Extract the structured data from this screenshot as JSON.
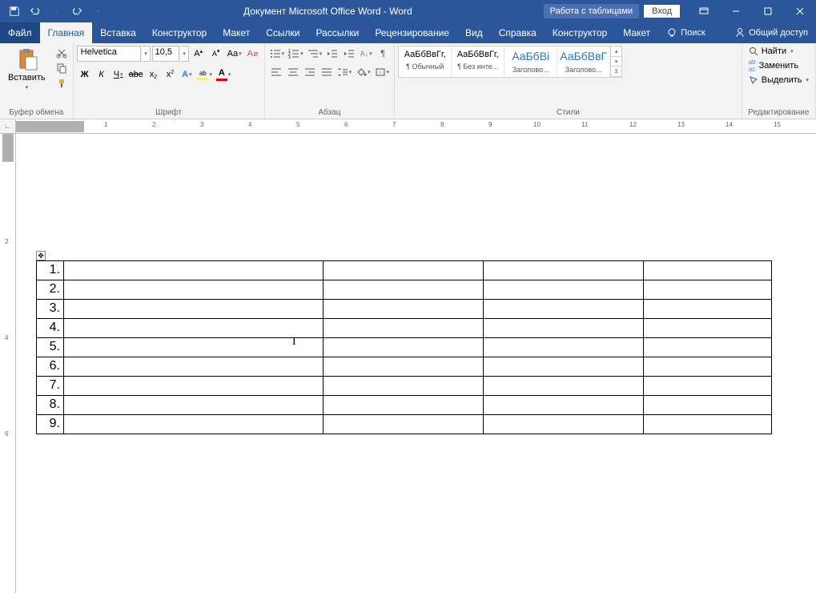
{
  "title": "Документ Microsoft Office Word - Word",
  "table_tools": "Работа с таблицами",
  "login": "Вход",
  "tabs": {
    "file": "Файл",
    "home": "Главная",
    "insert": "Вставка",
    "design": "Конструктор",
    "layout": "Макет",
    "refs": "Ссылки",
    "mail": "Рассылки",
    "review": "Рецензирование",
    "view": "Вид",
    "help": "Справка",
    "t_design": "Конструктор",
    "t_layout": "Макет",
    "search": "Поиск",
    "share": "Общий доступ"
  },
  "groups": {
    "clipboard": "Буфер обмена",
    "font": "Шрифт",
    "paragraph": "Абзац",
    "styles": "Стили",
    "editing": "Редактирование"
  },
  "clipboard": {
    "paste": "Вставить"
  },
  "font": {
    "name": "Helvetica",
    "size": "10,5",
    "bold": "Ж",
    "italic": "К",
    "underline": "Ч",
    "strike": "abc",
    "sub": "x",
    "sup": "x",
    "caseA": "Aa",
    "aBig": "A",
    "aSmall": "A",
    "clearA": "A",
    "textFx": "A",
    "highlight": "A"
  },
  "styles": [
    {
      "prev": "АаБбВвГг,",
      "name": "¶ Обычный",
      "cls": ""
    },
    {
      "prev": "АаБбВвГг,",
      "name": "¶ Без инте...",
      "cls": ""
    },
    {
      "prev": "АаБбВі",
      "name": "Заголово...",
      "cls": "big"
    },
    {
      "prev": "АаБбВвГ",
      "name": "Заголово...",
      "cls": "big"
    }
  ],
  "editing": {
    "find": "Найти",
    "replace": "Заменить",
    "select": "Выделить"
  },
  "table_rows": [
    "1.",
    "2.",
    "3.",
    "4.",
    "5.",
    "6.",
    "7.",
    "8.",
    "9."
  ],
  "p": "¶"
}
